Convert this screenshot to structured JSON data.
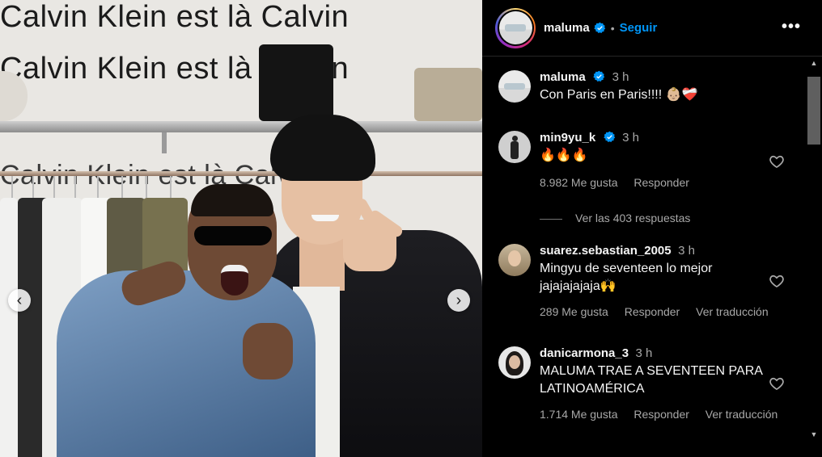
{
  "photo": {
    "wall_text_line_1": "Calvin Klein est là Calvin",
    "wall_text_line_2": "Calvin Klein est là Calvin",
    "wall_text_line_3": "Calvin Klein est là Calvin",
    "prev_icon": "chevron-left-icon",
    "next_icon": "chevron-right-icon",
    "prev_glyph": "‹",
    "next_glyph": "›"
  },
  "header": {
    "username": "maluma",
    "separator": "•",
    "follow_label": "Seguir",
    "more_glyph": "•••",
    "verified_color": "#0095f6"
  },
  "comments": [
    {
      "username": "maluma",
      "time": "3 h",
      "text": "Con Paris en Paris!!!! 👶🏼❤️‍🩹",
      "verified": true
    },
    {
      "username": "min9yu_k",
      "time": "3 h",
      "text": "🔥🔥🔥",
      "verified": true,
      "likes": "8.982 Me gusta",
      "reply": "Responder",
      "view_replies": "Ver las 403 respuestas"
    },
    {
      "username": "suarez.sebastian_2005",
      "time": "3 h",
      "text": "Mingyu de seventeen lo mejor jajajajajaja🙌",
      "likes": "289 Me gusta",
      "reply": "Responder",
      "translate": "Ver traducción"
    },
    {
      "username": "danicarmona_3",
      "time": "3 h",
      "text": "MALUMA TRAE A SEVENTEEN PARA LATINOAMÉRICA",
      "likes": "1.714 Me gusta",
      "reply": "Responder",
      "translate": "Ver traducción"
    }
  ],
  "colors": {
    "background": "#000000",
    "text": "#f5f5f5",
    "secondary_text": "#a8a8a8",
    "accent": "#0095f6"
  },
  "scrollbar": {
    "up_glyph": "▲",
    "down_glyph": "▼"
  }
}
